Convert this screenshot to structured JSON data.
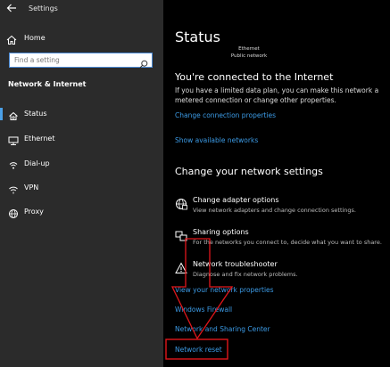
{
  "window": {
    "title": "Settings"
  },
  "sidebar": {
    "home_label": "Home",
    "search_placeholder": "Find a setting",
    "section_title": "Network & Internet",
    "items": [
      {
        "label": "Status",
        "icon": "home-globe-icon",
        "active": true
      },
      {
        "label": "Ethernet",
        "icon": "ethernet-icon"
      },
      {
        "label": "Dial-up",
        "icon": "dial-up-icon"
      },
      {
        "label": "VPN",
        "icon": "vpn-icon"
      },
      {
        "label": "Proxy",
        "icon": "globe-icon"
      }
    ]
  },
  "main": {
    "title": "Status",
    "network": {
      "name": "Ethernet",
      "type": "Public network"
    },
    "connected_heading": "You're connected to the Internet",
    "connected_desc": "If you have a limited data plan, you can make this network a metered connection or change other properties.",
    "change_props_link": "Change connection properties",
    "show_networks_link": "Show available networks",
    "change_heading": "Change your network settings",
    "options": [
      {
        "title": "Change adapter options",
        "desc": "View network adapters and change connection settings.",
        "icon": "adapter-icon"
      },
      {
        "title": "Sharing options",
        "desc": "For the networks you connect to, decide what you want to share.",
        "icon": "sharing-icon"
      },
      {
        "title": "Network troubleshooter",
        "desc": "Diagnose and fix network problems.",
        "icon": "warning-icon"
      }
    ],
    "links": {
      "view_properties": "View your network properties",
      "firewall": "Windows Firewall",
      "sharing_center": "Network and Sharing Center",
      "reset": "Network reset"
    }
  },
  "colors": {
    "accent": "#3c9be6",
    "sidebar_bg": "#2b2b2b",
    "annotation": "#e0161b"
  }
}
